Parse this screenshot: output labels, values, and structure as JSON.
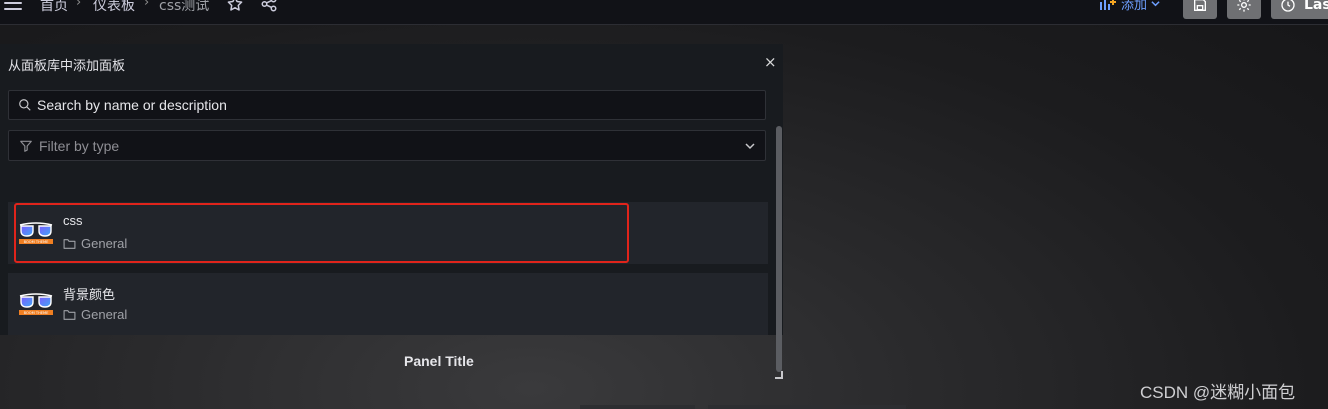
{
  "topbar": {
    "breadcrumbs": [
      "首页",
      "仪表板",
      "css测试"
    ],
    "add_label": "添加",
    "time_label": "Las"
  },
  "library": {
    "title": "从面板库中添加面板",
    "close_glyph": "×",
    "search": {
      "placeholder": "Search by name or description",
      "value": ""
    },
    "filter": {
      "placeholder": "Filter by type"
    },
    "results": [
      {
        "name": "css",
        "folder": "General",
        "thumb_text": "BOOM THEME"
      },
      {
        "name": "背景颜色",
        "folder": "General",
        "thumb_text": "BOOM THEME"
      }
    ]
  },
  "dashboard": {
    "panel_title": "Panel Title"
  },
  "watermark": "CSDN @迷糊小面包",
  "colors": {
    "accent_link": "#6e9fff",
    "highlight_border": "#e0241b",
    "thumb_lens_a": "#7b5cff",
    "thumb_lens_b": "#3fa9f5",
    "thumb_banner": "#f07f22"
  }
}
